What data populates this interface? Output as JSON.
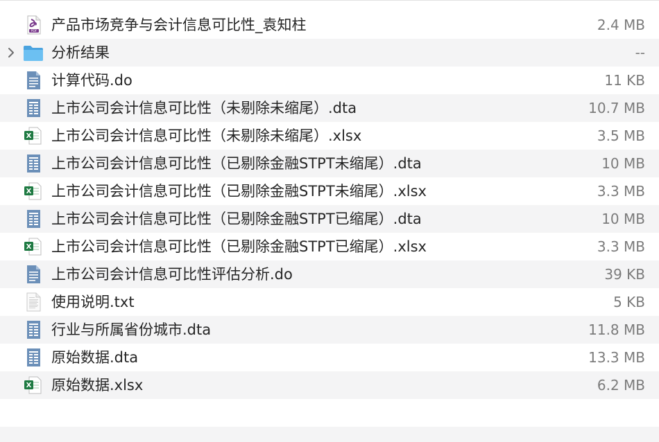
{
  "files": [
    {
      "name": "产品市场竞争与会计信息可比性_袁知柱",
      "size": "2.4 MB",
      "icon": "pdf-icon",
      "expandable": false
    },
    {
      "name": "分析结果",
      "size": "--",
      "icon": "folder-icon",
      "expandable": true
    },
    {
      "name": "计算代码.do",
      "size": "11 KB",
      "icon": "do-file-icon",
      "expandable": false
    },
    {
      "name": "上市公司会计信息可比性（未剔除未缩尾）.dta",
      "size": "10.7 MB",
      "icon": "dta-file-icon",
      "expandable": false
    },
    {
      "name": "上市公司会计信息可比性（未剔除未缩尾）.xlsx",
      "size": "3.5 MB",
      "icon": "excel-icon",
      "expandable": false
    },
    {
      "name": "上市公司会计信息可比性（已剔除金融STPT未缩尾）.dta",
      "size": "10 MB",
      "icon": "dta-file-icon",
      "expandable": false
    },
    {
      "name": "上市公司会计信息可比性（已剔除金融STPT未缩尾）.xlsx",
      "size": "3.3 MB",
      "icon": "excel-icon",
      "expandable": false
    },
    {
      "name": "上市公司会计信息可比性（已剔除金融STPT已缩尾）.dta",
      "size": "10 MB",
      "icon": "dta-file-icon",
      "expandable": false
    },
    {
      "name": "上市公司会计信息可比性（已剔除金融STPT已缩尾）.xlsx",
      "size": "3.3 MB",
      "icon": "excel-icon",
      "expandable": false
    },
    {
      "name": "上市公司会计信息可比性评估分析.do",
      "size": "39 KB",
      "icon": "do-file-icon",
      "expandable": false
    },
    {
      "name": "使用说明.txt",
      "size": "5 KB",
      "icon": "txt-file-icon",
      "expandable": false
    },
    {
      "name": "行业与所属省份城市.dta",
      "size": "11.8 MB",
      "icon": "dta-file-icon",
      "expandable": false
    },
    {
      "name": "原始数据.dta",
      "size": "13.3 MB",
      "icon": "dta-file-icon",
      "expandable": false
    },
    {
      "name": "原始数据.xlsx",
      "size": "6.2 MB",
      "icon": "excel-icon",
      "expandable": false
    }
  ],
  "colors": {
    "row_stripe": "#f4f4f5",
    "name_text": "#252525",
    "size_text": "#7b7b7b",
    "folder": "#5fb3ea",
    "excel": "#1e7a42",
    "pdf": "#7a3a8c"
  }
}
